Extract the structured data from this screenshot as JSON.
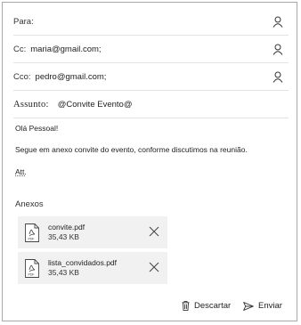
{
  "fields": {
    "para_label": "Para:",
    "cc_label": "Cc:",
    "cc_value": "maria@gmail.com;",
    "cco_label": "Cco:",
    "cco_value": "pedro@gmail.com;",
    "subject_label": "Assunto:",
    "subject_value": "@Convite Evento@"
  },
  "message": {
    "greeting": "Olá Pessoal!",
    "line1": "Segue em anexo convite do evento, conforme discutimos na reunião.",
    "signoff": "Att."
  },
  "attachments": {
    "label": "Anexos",
    "files": [
      {
        "name": "convite.pdf",
        "size": "35,43 KB"
      },
      {
        "name": "lista_convidados.pdf",
        "size": "35,43 KB"
      }
    ]
  },
  "actions": {
    "discard_label": "Descartar",
    "send_label": "Enviar"
  },
  "icons": {
    "contact": "person-icon",
    "file": "pdf-file-icon",
    "remove": "close-icon",
    "discard": "trash-icon",
    "send": "send-icon"
  }
}
